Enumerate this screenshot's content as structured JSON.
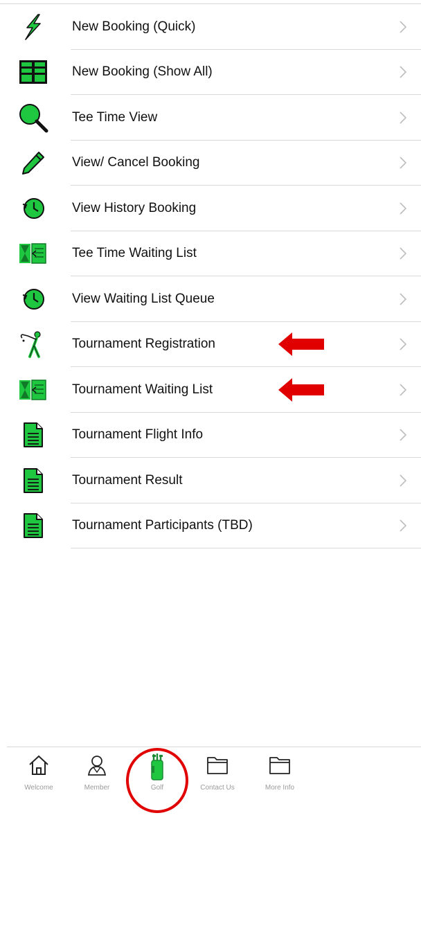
{
  "menu": {
    "items": [
      {
        "label": "New Booking (Quick)",
        "icon": "lightning-bolt-icon"
      },
      {
        "label": "New Booking (Show All)",
        "icon": "grid-icon"
      },
      {
        "label": "Tee Time View",
        "icon": "magnifier-icon"
      },
      {
        "label": "View/ Cancel Booking",
        "icon": "pencil-icon"
      },
      {
        "label": "View History Booking",
        "icon": "history-clock-icon"
      },
      {
        "label": "Tee Time Waiting List",
        "icon": "waiting-list-icon"
      },
      {
        "label": "View Waiting List Queue",
        "icon": "history-clock-icon"
      },
      {
        "label": "Tournament Registration",
        "icon": "golfer-icon",
        "highlight_arrow": true
      },
      {
        "label": "Tournament Waiting List",
        "icon": "waiting-list-icon",
        "highlight_arrow": true
      },
      {
        "label": "Tournament Flight Info",
        "icon": "document-icon"
      },
      {
        "label": "Tournament Result",
        "icon": "document-icon"
      },
      {
        "label": "Tournament Participants (TBD)",
        "icon": "document-icon"
      }
    ]
  },
  "tabbar": {
    "tabs": [
      {
        "label": "Welcome",
        "icon": "home-icon"
      },
      {
        "label": "Member",
        "icon": "person-icon"
      },
      {
        "label": "Golf",
        "icon": "golf-bag-icon",
        "selected": true
      },
      {
        "label": "Contact Us",
        "icon": "folder-icon"
      },
      {
        "label": "More Info",
        "icon": "folder-icon"
      }
    ]
  },
  "colors": {
    "icon_green": "#1fc640",
    "annotation_red": "#e00000",
    "divider": "#d9d9d9",
    "tab_label": "#9a9a9a"
  }
}
